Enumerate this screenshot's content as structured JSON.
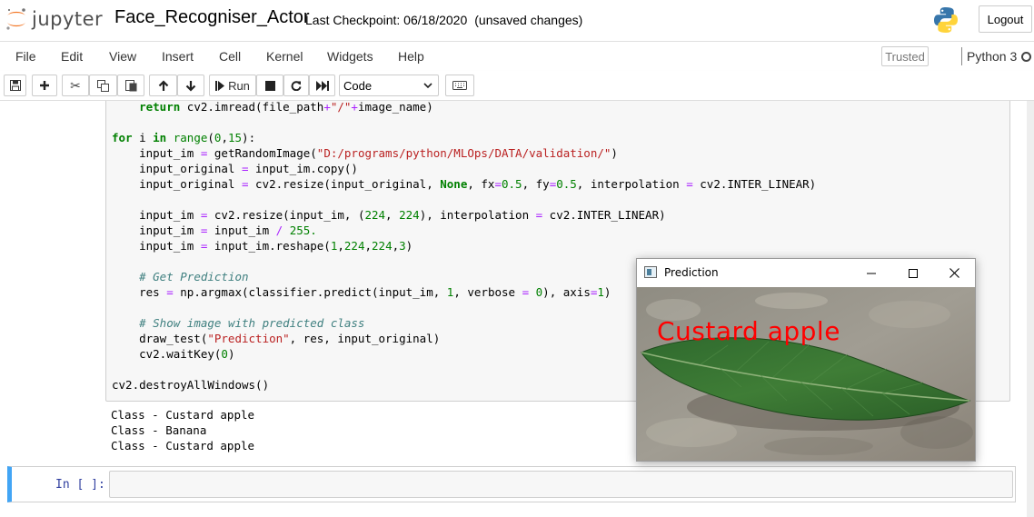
{
  "header": {
    "logo_text": "jupyter",
    "notebook_name": "Face_Recogniser_Actor",
    "checkpoint_text": "Last Checkpoint: 06/18/2020",
    "save_status": "(unsaved changes)",
    "logout_label": "Logout",
    "brand_color": "#f37726"
  },
  "menubar": {
    "items": [
      "File",
      "Edit",
      "View",
      "Insert",
      "Cell",
      "Kernel",
      "Widgets",
      "Help"
    ],
    "trusted_label": "Trusted",
    "kernel_name": "Python 3"
  },
  "toolbar": {
    "run_label": "Run",
    "cell_type": "Code",
    "icons": [
      "save-icon",
      "plus-icon",
      "cut-icon",
      "copy-icon",
      "paste-icon",
      "arrow-up-icon",
      "arrow-down-icon",
      "step-forward-icon",
      "stop-icon",
      "restart-icon",
      "fast-forward-icon",
      "keyboard-icon"
    ]
  },
  "cell1": {
    "code_lines": [
      "    return cv2.imread(file_path+\"/\"+image_name)",
      "",
      "for i in range(0,15):",
      "    input_im = getRandomImage(\"D:/programs/python/MLOps/DATA/validation/\")",
      "    input_original = input_im.copy()",
      "    input_original = cv2.resize(input_original, None, fx=0.5, fy=0.5, interpolation = cv2.INTER_LINEAR)",
      "",
      "    input_im = cv2.resize(input_im, (224, 224), interpolation = cv2.INTER_LINEAR)",
      "    input_im = input_im / 255.",
      "    input_im = input_im.reshape(1,224,224,3)",
      "",
      "    # Get Prediction",
      "    res = np.argmax(classifier.predict(input_im, 1, verbose = 0), axis=1)",
      "",
      "    # Show image with predicted class",
      "    draw_test(\"Prediction\", res, input_original)",
      "    cv2.waitKey(0)",
      "",
      "cv2.destroyAllWindows()"
    ],
    "output_lines": [
      "Class - Custard apple",
      "Class - Banana",
      "Class - Custard apple"
    ]
  },
  "cell2": {
    "prompt": "In [ ]:"
  },
  "prediction_window": {
    "title": "Prediction",
    "label": "Custard apple",
    "label_color": "#ff0000"
  }
}
